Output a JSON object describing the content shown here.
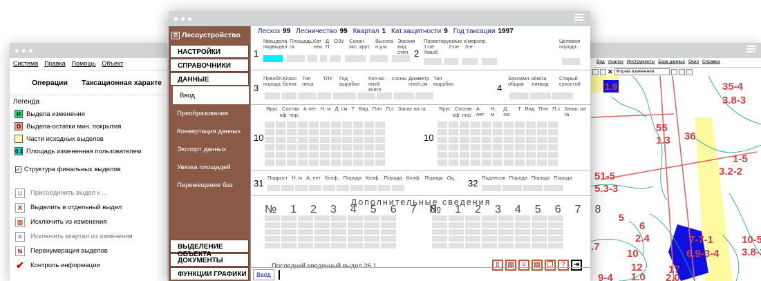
{
  "left_window": {
    "menu": [
      "Система",
      "Правка",
      "Помощь",
      "Объект"
    ],
    "tabs": [
      "Операции",
      "Таксационная характе"
    ],
    "legend_title": "Легенда",
    "legend": [
      {
        "mark": "И",
        "label": "Выдела изменения",
        "color": "#19e07a"
      },
      {
        "mark": "О",
        "label": "Выдела-остатки мин. покрытия",
        "color": "#ff9c8c"
      },
      {
        "mark": "",
        "label": "Части исходных выделов",
        "color": "#fffcb0"
      },
      {
        "mark": "0.1",
        "label": "Площадь измененная пользователем",
        "color": "#19d4c8"
      }
    ],
    "structure_checkbox": "Структура финальных выделов",
    "operations": [
      {
        "icon": "U",
        "label": "Присоединить выдел к ...",
        "color": "#888888",
        "enabled": false
      },
      {
        "icon": "X",
        "label": "Выделить в отдельный выдел",
        "color": "#d40000",
        "enabled": true
      },
      {
        "icon": "▥",
        "label": "Исключить из изменения",
        "color": "#c05532",
        "enabled": true
      },
      {
        "icon": "✕",
        "label": "Исключить квартал из изменения",
        "color": "#888888",
        "enabled": false
      },
      {
        "icon": "N",
        "label": "Перенумерация выделов",
        "color": "#d40000",
        "enabled": true
      },
      {
        "icon": "✔",
        "label": "Контроль информации",
        "color": "#d40000",
        "enabled": true
      }
    ]
  },
  "main_window": {
    "app_title": "Лесоустройство",
    "top_sections": [
      "НАСТРОЙКИ",
      "СПРАВОЧНИКИ",
      "ДАННЫЕ"
    ],
    "submenu": [
      "Ввод",
      "Преобразования",
      "Конвертация данных",
      "Экспорт данных",
      "Увязка площадей",
      "Перемещение баз"
    ],
    "active_submenu": "Ввод",
    "bottom_sections": [
      "ВЫДЕЛЕНИЕ ОБЪЕКТА",
      "ДОКУМЕНТЫ",
      "ФУНКЦИИ ГРАФИКИ"
    ],
    "header": [
      {
        "label": "Лесхоз",
        "value": "99"
      },
      {
        "label": "Лесничество",
        "value": "99"
      },
      {
        "label": "Квартал",
        "value": "1"
      },
      {
        "label": "Кат.защитности",
        "value": "9"
      },
      {
        "label": "Год таксации",
        "value": "1997"
      }
    ],
    "block1": {
      "num": "1",
      "cols": [
        "№выдела подвыдел",
        "Площадь, га",
        "Кат зем.",
        "Д П",
        "ОЗУ",
        "Склон экс. крут.",
        "Высота н.у.м",
        "Эрозия вид степ."
      ]
    },
    "block2": {
      "num": "2",
      "cols": [
        "Проектируемые х/меропр.",
        "1-ое %выб",
        "2-ое",
        "3-е",
        "Целевая порода"
      ]
    },
    "block3": {
      "num": "3",
      "cols": [
        "Преобл. порода",
        "Класс бонит.",
        "Тип леса",
        "ТЛУ",
        "Год вырубки",
        "Кол-во пней всего",
        "сосны",
        "Диаметр пней,см",
        "Тип вырубки"
      ]
    },
    "block4": {
      "num": "4",
      "cols": [
        "Захламл. общая",
        "к6м/га ликвид",
        "Старый сухостой"
      ]
    },
    "block10": {
      "num": "10",
      "cols": [
        "Ярус",
        "Состав",
        "кф. пор.",
        "А лет",
        "Н, м",
        "Д, см",
        "Т",
        "Вид",
        "Плн",
        "П.с",
        "Запас на га"
      ]
    },
    "block31": {
      "num": "31",
      "cols": [
        "Подрост",
        "Н, м",
        "А, лет",
        "Коэф.",
        "Порода",
        "Коэф.",
        "Порода",
        "Коэф.",
        "Порода",
        "Оц."
      ]
    },
    "block32": {
      "num": "32",
      "cols": [
        "Подлесок",
        "Порода",
        "Порода",
        "Порода"
      ]
    },
    "extra_title": "Дополнительные сведения",
    "extra_cols": [
      "№",
      "1",
      "2",
      "3",
      "4",
      "5",
      "6",
      "7",
      "8"
    ],
    "last_label": "Последний введенный выдел",
    "last_value": "26 1",
    "input_button": "Ввод"
  },
  "map_window": {
    "menu": [
      "Вид",
      "Анализ",
      "Инструменты",
      "База данных",
      "Окно",
      "Справка"
    ],
    "layer_select": "Форма изменения",
    "labels": [
      "1.9",
      "35-4",
      "3.8-3",
      "55",
      "1.3",
      "36",
      "1-5",
      "3.2-2",
      "51-5",
      "5.3-3",
      "5",
      "6",
      "2.4",
      ".7",
      "10",
      "7-7-1",
      "6.9-3-4",
      "10-5",
      "3.8-3",
      "12",
      "1.0",
      "17",
      "2.0",
      "9-4"
    ]
  }
}
